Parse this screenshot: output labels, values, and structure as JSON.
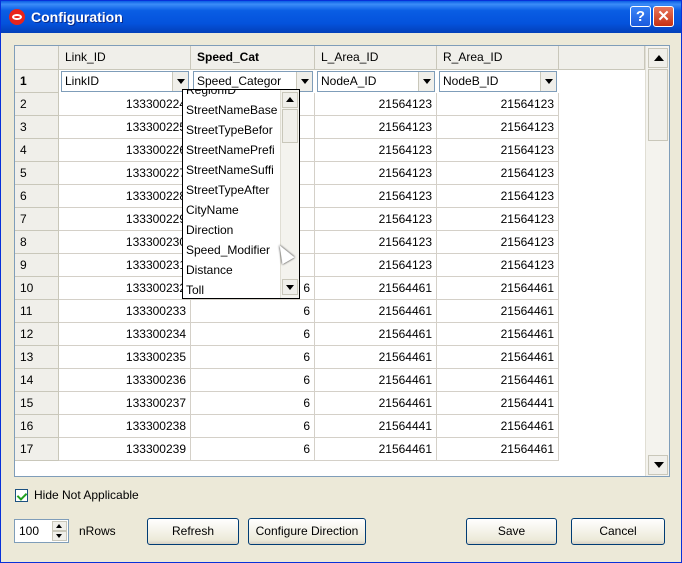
{
  "window": {
    "title": "Configuration",
    "help_glyph": "?",
    "close_glyph": "✕"
  },
  "columns": [
    {
      "label": "Link_ID",
      "bold": false
    },
    {
      "label": "Speed_Cat",
      "bold": true
    },
    {
      "label": "L_Area_ID",
      "bold": false
    },
    {
      "label": "R_Area_ID",
      "bold": false
    }
  ],
  "mapping_row": {
    "row_label": "1",
    "link": "LinkID",
    "speed": "Speed_Categor",
    "l_area": "NodeA_ID",
    "r_area": "NodeB_ID"
  },
  "rows": [
    {
      "n": "2",
      "link": "133300224",
      "speed": "",
      "l": "21564123",
      "r": "21564123"
    },
    {
      "n": "3",
      "link": "133300225",
      "speed": "",
      "l": "21564123",
      "r": "21564123"
    },
    {
      "n": "4",
      "link": "133300226",
      "speed": "",
      "l": "21564123",
      "r": "21564123"
    },
    {
      "n": "5",
      "link": "133300227",
      "speed": "",
      "l": "21564123",
      "r": "21564123"
    },
    {
      "n": "6",
      "link": "133300228",
      "speed": "",
      "l": "21564123",
      "r": "21564123"
    },
    {
      "n": "7",
      "link": "133300229",
      "speed": "",
      "l": "21564123",
      "r": "21564123"
    },
    {
      "n": "8",
      "link": "133300230",
      "speed": "",
      "l": "21564123",
      "r": "21564123"
    },
    {
      "n": "9",
      "link": "133300231",
      "speed": "",
      "l": "21564123",
      "r": "21564123"
    },
    {
      "n": "10",
      "link": "133300232",
      "speed": "6",
      "l": "21564461",
      "r": "21564461"
    },
    {
      "n": "11",
      "link": "133300233",
      "speed": "6",
      "l": "21564461",
      "r": "21564461"
    },
    {
      "n": "12",
      "link": "133300234",
      "speed": "6",
      "l": "21564461",
      "r": "21564461"
    },
    {
      "n": "13",
      "link": "133300235",
      "speed": "6",
      "l": "21564461",
      "r": "21564461"
    },
    {
      "n": "14",
      "link": "133300236",
      "speed": "6",
      "l": "21564461",
      "r": "21564461"
    },
    {
      "n": "15",
      "link": "133300237",
      "speed": "6",
      "l": "21564461",
      "r": "21564441"
    },
    {
      "n": "16",
      "link": "133300238",
      "speed": "6",
      "l": "21564441",
      "r": "21564461"
    },
    {
      "n": "17",
      "link": "133300239",
      "speed": "6",
      "l": "21564461",
      "r": "21564461"
    }
  ],
  "dropdown": {
    "items": [
      "RegionID",
      "StreetNameBase",
      "StreetTypeBefor",
      "StreetNamePrefi",
      "StreetNameSuffi",
      "StreetTypeAfter",
      "CityName",
      "Direction",
      "Speed_Modifier",
      "Distance",
      "Toll"
    ]
  },
  "options": {
    "hide_not_applicable": "Hide Not Applicable",
    "hide_checked": true
  },
  "footer": {
    "nrows_value": "100",
    "nrows_label": "nRows",
    "refresh": "Refresh",
    "configure_direction": "Configure Direction",
    "save": "Save",
    "cancel": "Cancel"
  }
}
